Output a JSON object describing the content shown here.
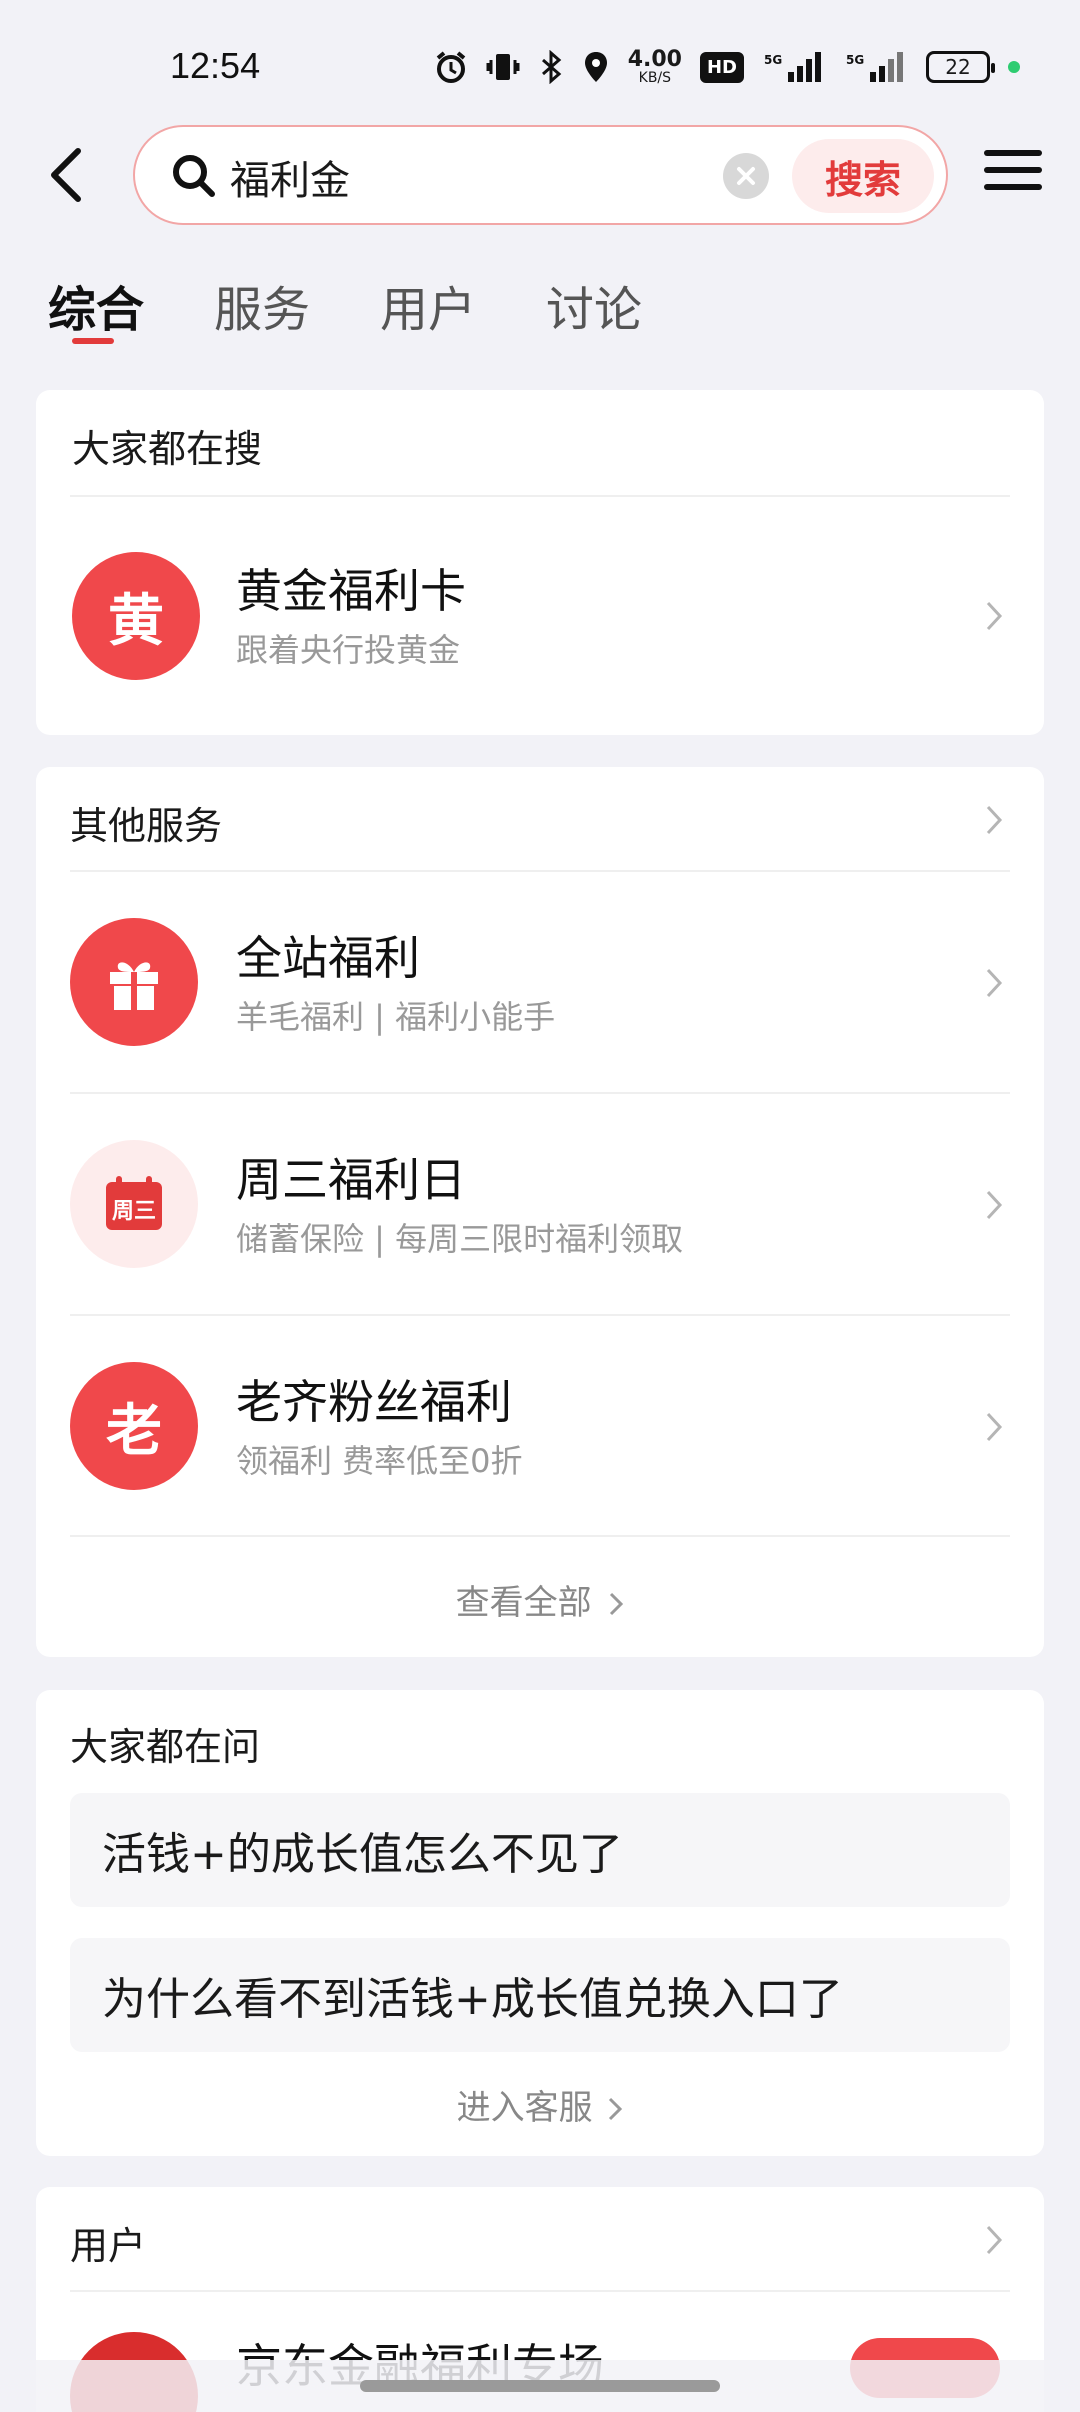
{
  "status_bar": {
    "time": "12:54",
    "net_speed_value": "4.00",
    "net_speed_unit": "KB/S",
    "hd_label": "HD",
    "battery": "22"
  },
  "search": {
    "query": "福利金",
    "search_button_label": "搜索"
  },
  "tabs": [
    "综合",
    "服务",
    "用户",
    "讨论"
  ],
  "everyone_searching": {
    "title": "大家都在搜",
    "item": {
      "icon_char": "黄",
      "name": "黄金福利卡",
      "desc": "跟着央行投黄金"
    }
  },
  "other_services": {
    "title": "其他服务",
    "items": [
      {
        "icon": "gift-icon",
        "name": "全站福利",
        "desc": "羊毛福利 | 福利小能手"
      },
      {
        "icon": "calendar-icon",
        "icon_text": "周三",
        "name": "周三福利日",
        "desc": "储蓄保险 | 每周三限时福利领取"
      },
      {
        "icon_char": "老",
        "name": "老齐粉丝福利",
        "desc": "领福利 费率低至0折"
      }
    ],
    "see_all_label": "查看全部"
  },
  "everyone_asking": {
    "title": "大家都在问",
    "questions": [
      "活钱+的成长值怎么不见了",
      "为什么看不到活钱+成长值兑换入口了"
    ],
    "customer_service_label": "进入客服"
  },
  "users": {
    "title": "用户",
    "first_user_name_partial": "京东金融福利专场"
  },
  "colors": {
    "accent": "#e23b3b",
    "background": "#f2f2f7"
  }
}
